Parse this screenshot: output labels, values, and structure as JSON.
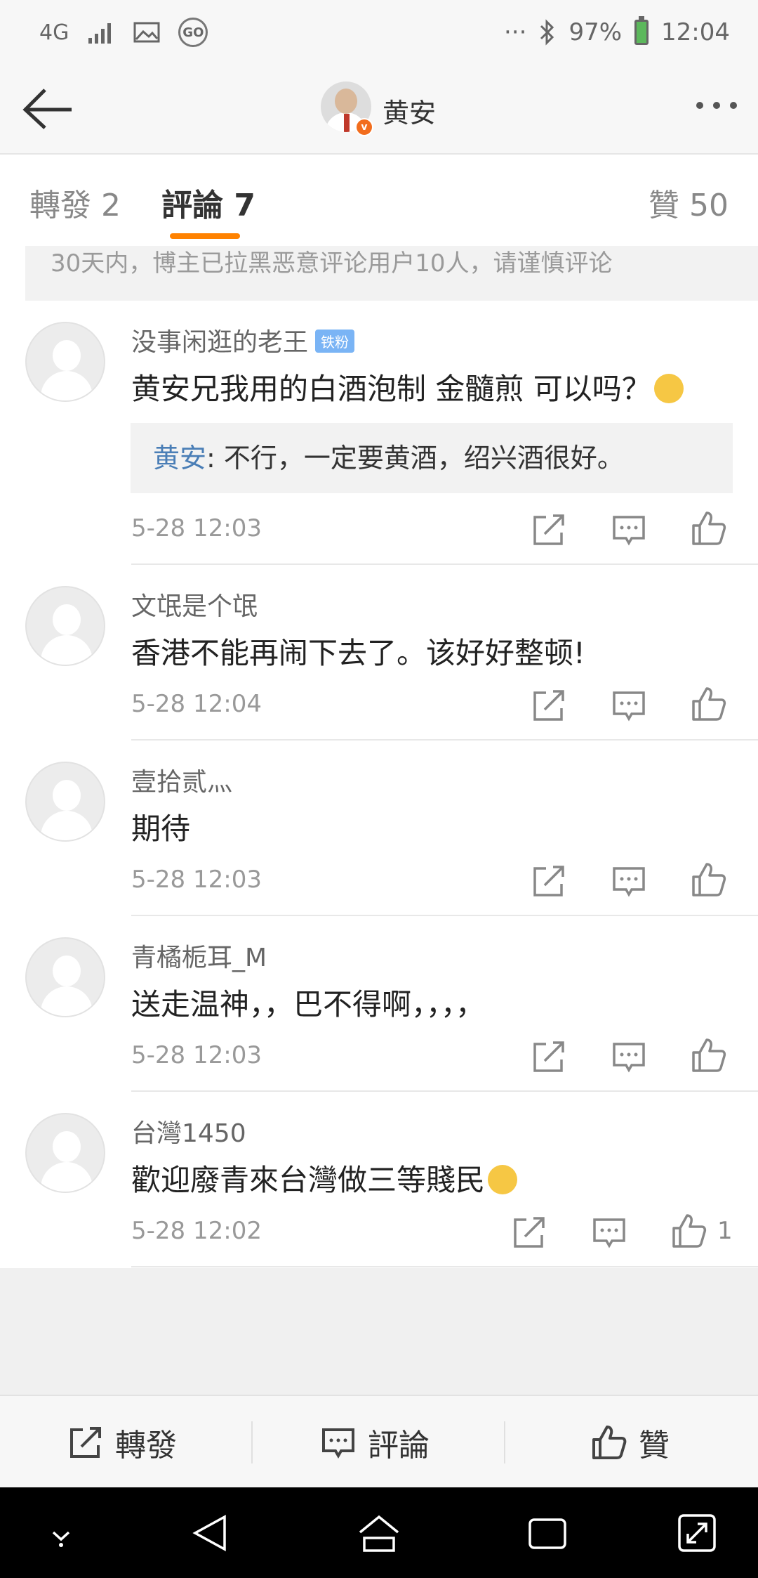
{
  "status_bar": {
    "network": "4G",
    "go_label": "GO",
    "more": "···",
    "battery": "97%",
    "time": "12:04"
  },
  "header": {
    "name": "黄安",
    "verified_badge": "v"
  },
  "tabs": [
    {
      "label": "轉發 2"
    },
    {
      "label": "評論 7"
    },
    {
      "label": "贊 50"
    }
  ],
  "notice": "30天内，博主已拉黑恶意评论用户10人，请谨慎评论",
  "comments": [
    {
      "user": "没事闲逛的老王",
      "badge": "铁粉",
      "text": "黄安兄我用的白酒泡制 金髓煎 可以吗？",
      "reply_name": "黄安",
      "reply_text": ": 不行，一定要黄酒，绍兴酒很好。",
      "time": "5-28 12:03"
    },
    {
      "user": "文氓是个氓",
      "text": "香港不能再闹下去了。该好好整顿!",
      "time": "5-28 12:04"
    },
    {
      "user": "壹拾贰灬",
      "text": "期待",
      "time": "5-28 12:03"
    },
    {
      "user": "青橘栀耳_M",
      "text": "送走温神，，巴不得啊，，，，",
      "time": "5-28 12:03"
    },
    {
      "user": "台灣1450",
      "text": "歡迎廢青來台灣做三等賤民",
      "time": "5-28 12:02",
      "likes": "1"
    }
  ],
  "bottom_bar": {
    "repost": "轉發",
    "comment": "評論",
    "like": "贊"
  },
  "colors": {
    "accent": "#ff8200",
    "link": "#4a7eb6",
    "badge": "#7ab4f5"
  }
}
